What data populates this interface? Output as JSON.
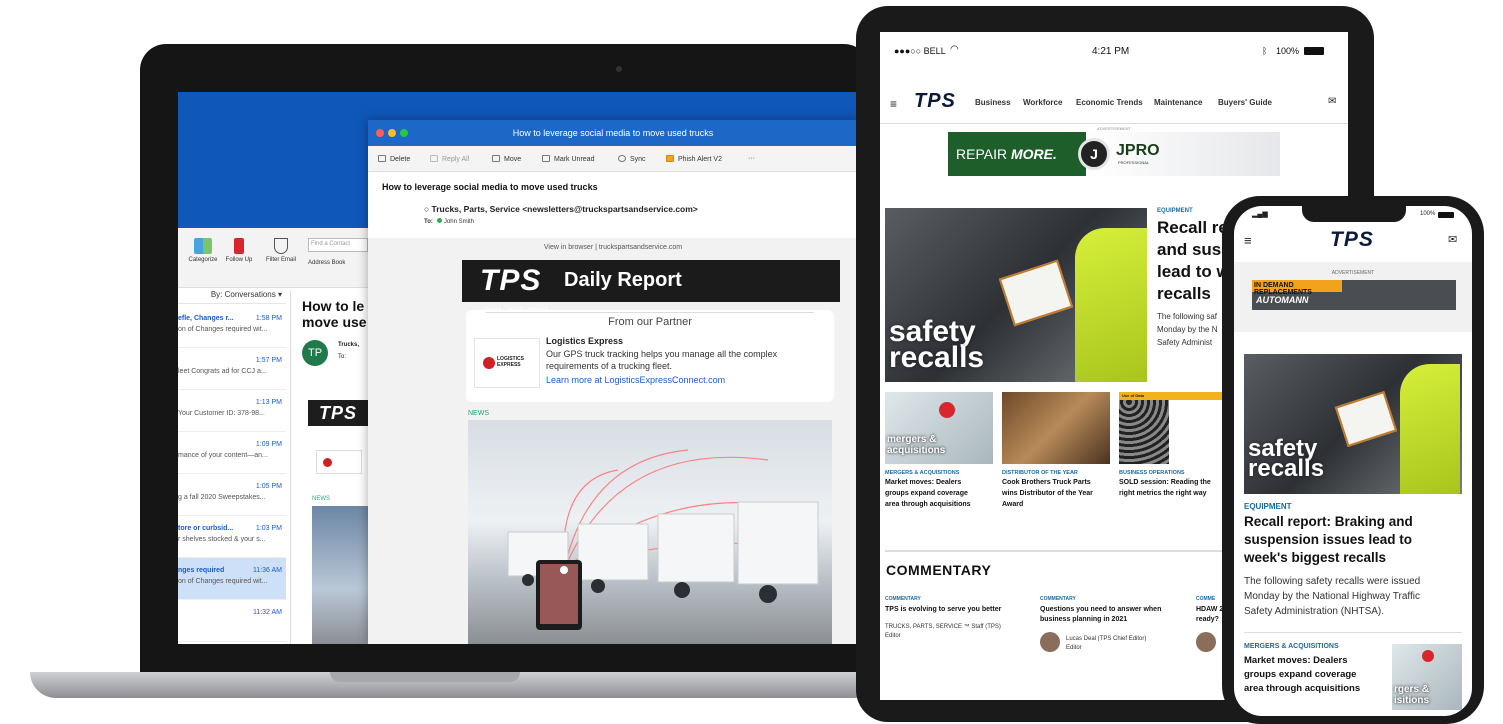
{
  "laptop": {
    "ribbon": {
      "categorize": "Categorize",
      "follow_up": "Follow Up",
      "filter_email": "Filter Email",
      "find_contact": "Find a Contact",
      "address_book": "Address Book"
    },
    "list_sort": "By: Conversations",
    "mail_list": [
      {
        "title": "efle, Changes r...",
        "time": "1:58 PM",
        "preview": "on of Changes required wit..."
      },
      {
        "title": "",
        "time": "1:57 PM",
        "preview": "leet Congrats ad for CCJ a..."
      },
      {
        "title": "",
        "time": "1:13 PM",
        "preview": "Your Customer ID: 378-98..."
      },
      {
        "title": "",
        "time": "1:09 PM",
        "preview": "mance of your content—an..."
      },
      {
        "title": "",
        "time": "1:05 PM",
        "preview": "g a fall 2020 Sweepstakes..."
      },
      {
        "title": "tore or curbsid...",
        "time": "1:03 PM",
        "preview": "r shelves stocked & your s..."
      },
      {
        "title": "nges required",
        "time": "11:36 AM",
        "preview": "on of Changes required wit..."
      },
      {
        "title": "",
        "time": "11:32 AM",
        "preview": ""
      }
    ],
    "reading_title": "How to le move use",
    "avatar_initials": "TP",
    "from_short": "Trucks,",
    "to_short": "To:",
    "mini_news": "NEWS",
    "window": {
      "title": "How to leverage social media to move used trucks",
      "toolbar": {
        "delete": "Delete",
        "reply_all": "Reply All",
        "move": "Move",
        "mark_unread": "Mark Unread",
        "sync": "Sync",
        "phish": "Phish Alert V2",
        "more": "···"
      },
      "subject": "How to leverage social media to move used trucks",
      "from": "Trucks, Parts, Service <newsletters@truckspartsandservice.com>",
      "to_label": "To:",
      "to_name": "John Smith",
      "view_in_browser": "View in browser | truckspartsandservice.com",
      "banner_logo": "TPS",
      "banner_logo_sub": "TRUCKS • PARTS • SERVICE",
      "banner_title": "Daily Report",
      "partner_heading": "From our Partner",
      "partner_logo_text": "LOGISTICS EXPRESS",
      "partner_name": "Logistics Express",
      "partner_desc": "Our GPS truck tracking helps you manage all the complex requirements of a trucking fleet.",
      "partner_link": "Learn more at LogisticsExpressConnect.com",
      "news_label": "NEWS"
    }
  },
  "tablet": {
    "status": {
      "carrier": "●●●○○ BELL",
      "time": "4:21 PM",
      "battery": "100%"
    },
    "logo": "TPS",
    "nav": [
      "Business",
      "Workforce",
      "Economic Trends",
      "Maintenance",
      "Buyers' Guide"
    ],
    "ad_label": "ADVERTISEMENT",
    "ad_left": "REPAIR",
    "ad_left_bold": "MORE.",
    "ad_brand": "JPRO",
    "ad_brand_sub": "PROFESSIONAL",
    "hero_overlay": [
      "safety",
      "recalls"
    ],
    "hero_category": "EQUIPMENT",
    "hero_headline": [
      "Recall re",
      "and susp",
      "lead to w",
      "recalls"
    ],
    "hero_body": [
      "The following saf",
      "Monday by the N",
      "Safety Administ"
    ],
    "thumb_overlay_1": [
      "mergers &",
      "acquisitions"
    ],
    "thumb_overlay_3_tag": "Use of Data",
    "cards": [
      {
        "category": "MERGERS & ACQUISITIONS",
        "headline": [
          "Market moves: Dealers",
          "groups expand coverage",
          "area through acquisitions"
        ]
      },
      {
        "category": "DISTRIBUTOR OF THE YEAR",
        "headline": [
          "Cook Brothers Truck Parts",
          "wins Distributor of the Year",
          "Award"
        ]
      },
      {
        "category": "BUSINESS OPERATIONS",
        "headline": [
          "SOLD session: Reading the",
          "right metrics the right way"
        ]
      }
    ],
    "commentary_heading": "COMMENTARY",
    "commentary": [
      {
        "category": "COMMENTARY",
        "headline": [
          "TPS is evolving to serve you better"
        ],
        "author": "TRUCKS, PARTS, SERVICE ™ Staff (TPS)",
        "role": "Editor"
      },
      {
        "category": "COMMENTARY",
        "headline": [
          "Questions you need to answer when",
          "business planning in 2021"
        ],
        "author": "Lucas Deal (TPS Chief Editor)",
        "role": "Editor"
      },
      {
        "category": "COMME",
        "headline": [
          "HDAW 2",
          "ready?"
        ],
        "author": "",
        "role": ""
      }
    ]
  },
  "phone": {
    "status_battery": "100%",
    "logo": "TPS",
    "ad_label": "ADVERTISEMENT",
    "ad_text": "IN DEMAND REPLACEMENTS",
    "ad_brand": "AUTOMANN",
    "hero_overlay": [
      "safety",
      "recalls"
    ],
    "category": "EQUIPMENT",
    "headline": [
      "Recall report: Braking and",
      "suspension issues lead to",
      "week's biggest recalls"
    ],
    "body": [
      "The following safety recalls were issued",
      "Monday by the National Highway Traffic",
      "Safety Administration (NHTSA)."
    ],
    "card_category": "MERGERS & ACQUISITIONS",
    "card_headline": [
      "Market moves: Dealers",
      "groups expand coverage",
      "area through acquisitions"
    ],
    "card_overlay": [
      "rgers &",
      "isitions"
    ]
  },
  "colors": {
    "outlook_blue": "#1d68c7",
    "tps_navy": "#0b1a3a",
    "category_blue": "#1b6aa0",
    "vest_yellow": "#c6e02a",
    "ad_green": "#1e5e2b"
  },
  "icons": [
    "wifi-icon",
    "bluetooth-icon",
    "battery-icon",
    "hamburger-menu-icon",
    "mail-icon",
    "delete-icon",
    "reply-all-icon",
    "move-icon",
    "mark-unread-icon",
    "sync-icon",
    "phish-alert-icon",
    "flag-icon",
    "filter-icon",
    "categorize-icon"
  ]
}
